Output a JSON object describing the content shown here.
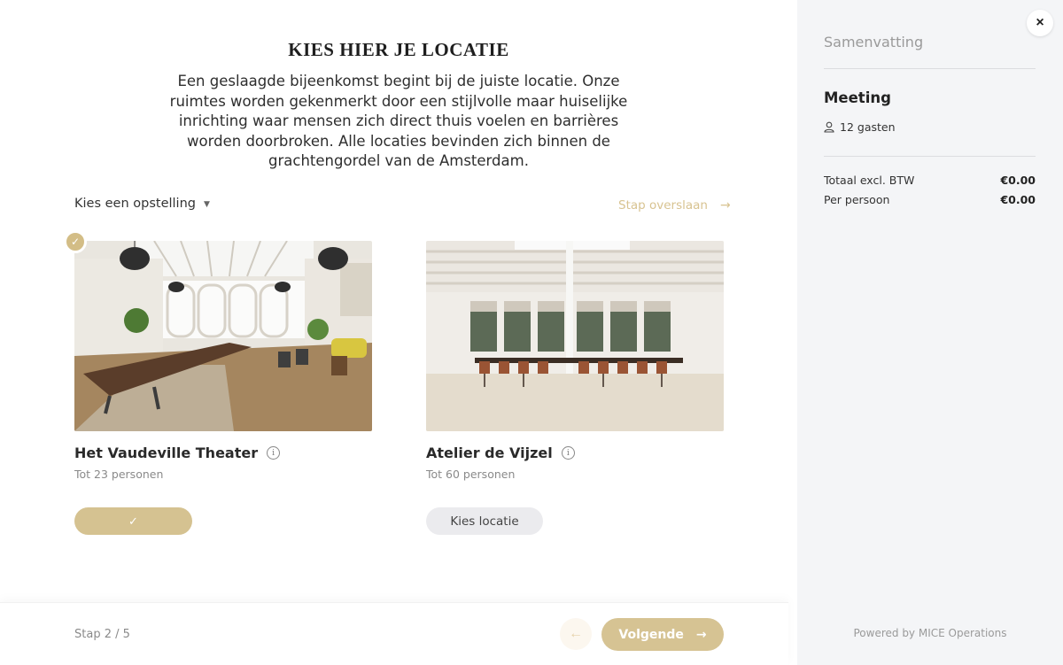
{
  "main": {
    "title": "KIES HIER JE LOCATIE",
    "intro": "Een geslaagde bijeenkomst begint bij de juiste locatie. Onze ruimtes worden gekenmerkt door een stijlvolle maar huiselijke inrichting waar mensen zich direct thuis voelen en barrières worden doorbroken. Alle locaties bevinden zich binnen de grachtengordel van de Amsterdam.",
    "filter_label": "Kies een opstelling",
    "skip_label": "Stap overslaan",
    "locations": [
      {
        "name": "Het Vaudeville Theater",
        "capacity": "Tot 23 personen",
        "selected": true,
        "button_label": "✓"
      },
      {
        "name": "Atelier de Vijzel",
        "capacity": "Tot 60 personen",
        "selected": false,
        "button_label": "Kies locatie"
      }
    ]
  },
  "footer": {
    "step": "Stap 2 / 5",
    "back_icon": "←",
    "next_label": "Volgende",
    "next_icon": "→"
  },
  "sidebar": {
    "title": "Samenvatting",
    "event_type": "Meeting",
    "guests": "12 gasten",
    "rows": [
      {
        "label": "Totaal excl. BTW",
        "value": "€0.00"
      },
      {
        "label": "Per persoon",
        "value": "€0.00"
      }
    ],
    "powered_by": "Powered by MICE Operations",
    "close_icon": "×"
  },
  "colors": {
    "accent": "#d5c291",
    "sidebar_bg": "#f4f5f7",
    "button_grey": "#ebebee"
  }
}
